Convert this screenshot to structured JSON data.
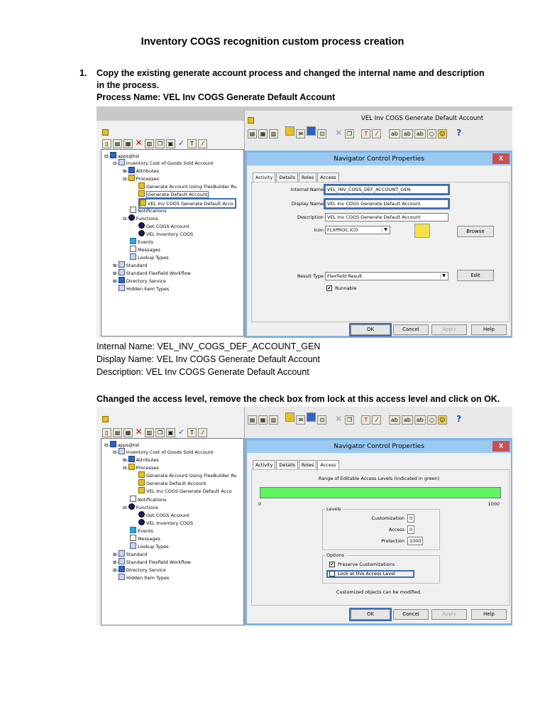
{
  "doc_title": "Inventory COGS recognition custom process creation",
  "step1": {
    "number": "1.",
    "text": "Copy the existing generate account process and changed the internal name and description in the process.",
    "process_name": "Process Name: VEL Inv COGS Generate Default Account"
  },
  "tree": {
    "root": "apps@tst",
    "item_type": "Inventory Cost of Goods Sold Account",
    "attributes": "Attributes",
    "processes": "Processes",
    "proc1": "Generate Account Using FlexBuilder Ru",
    "proc2": "Generate Default Account",
    "proc3": "VEL Inv COGS Generate Default Acco",
    "notifications": "Notifications",
    "functions": "Functions",
    "func1": "Get COGS Account",
    "func2": "VEL Inventory COGS",
    "events": "Events",
    "messages": "Messages",
    "lookup": "Lookup Types",
    "standard": "Standard",
    "flexfield": "Standard Flexfield Workflow",
    "directory": "Directory Service",
    "hidden": "Hidden Item Types"
  },
  "tree2": {
    "proc1": "Generate Account Using FlexBuilder Ru",
    "proc3": "VEL Inv COGS Generate Default Acco"
  },
  "shot1": {
    "window_title": "VEL Inv COGS Generate Default Account",
    "dialog_title": "Navigator Control Properties",
    "close": "X",
    "tabs": [
      "Activity",
      "Details",
      "Roles",
      "Access"
    ],
    "internal_name_label": "Internal Name",
    "internal_name_value": "VEL_INV_COGS_DEF_ACCOUNT_GEN",
    "display_name_label": "Display Name",
    "display_name_value": "VEL Inv COGS Generate Default Account",
    "description_label": "Description",
    "description_value": "VEL Inv COGS Generate Default Account",
    "icon_label": "Icon",
    "icon_value": "FLXPROC.ICO",
    "browse": "Browse",
    "result_type_label": "Result Type",
    "result_type_value": "Flexfield Result",
    "edit": "Edit",
    "runnable": "Runnable",
    "ok": "OK",
    "cancel": "Cancel",
    "apply": "Apply",
    "help": "Help"
  },
  "after_shot1": {
    "internal": "Internal Name: VEL_INV_COGS_DEF_ACCOUNT_GEN",
    "display": "Display Name: VEL Inv COGS Generate Default Account",
    "description": "Description: VEL Inv COGS Generate Default Account"
  },
  "step2_text": "Changed the access level, remove the check box from lock at this access level and click on OK.",
  "shot2": {
    "dialog_title": "Navigator Control Properties",
    "close": "X",
    "tabs": [
      "Activity",
      "Details",
      "Roles",
      "Access"
    ],
    "range_label": "Range of Editable Access Levels (indicated in green)",
    "range_min": "0",
    "range_max": "1000",
    "levels_label": "Levels",
    "customization_label": "Customization",
    "customization_value": "0",
    "access_label": "Access",
    "access_value": "0",
    "protection_label": "Protection",
    "protection_value": "1000",
    "options_label": "Options",
    "preserve": "Preserve Customizations",
    "lock": "Lock at this Access Level",
    "note": "Customized objects can be modified.",
    "ok": "OK",
    "cancel": "Cancel",
    "apply": "Apply",
    "help": "Help"
  },
  "colors": {
    "highlight": "#3d6db5",
    "access_bar": "#5ef55e",
    "dialog_title_bg": "#99c9f1",
    "close_bg": "#c75050"
  }
}
